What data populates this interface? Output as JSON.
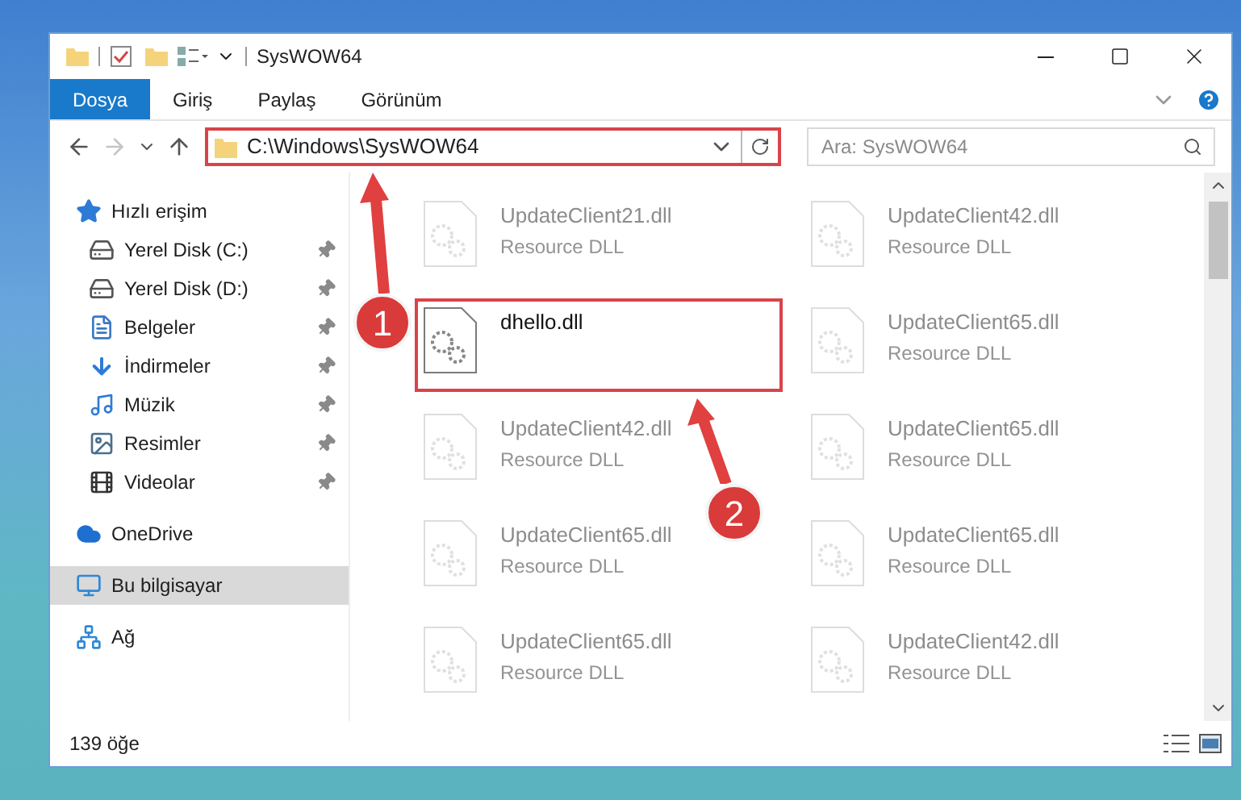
{
  "window": {
    "title": "SysWOW64"
  },
  "ribbon_tabs": [
    {
      "label": "Dosya",
      "selected": true
    },
    {
      "label": "Giriş",
      "selected": false
    },
    {
      "label": "Paylaş",
      "selected": false
    },
    {
      "label": "Görünüm",
      "selected": false
    }
  ],
  "address_bar": {
    "path": "C:\\Windows\\SysWOW64",
    "highlighted": true
  },
  "search": {
    "placeholder": "Ara: SysWOW64"
  },
  "sidebar": {
    "items": [
      {
        "label": "Hızlı erişim",
        "kind": "star",
        "selected": false,
        "children": [
          {
            "label": "Yerel Disk (C:)",
            "kind": "system-drive",
            "pinned": true,
            "selected": false
          },
          {
            "label": "Yerel Disk (D:)",
            "kind": "drive",
            "pinned": true,
            "selected": false
          },
          {
            "label": "Belgeler",
            "kind": "documents",
            "pinned": true,
            "selected": false
          },
          {
            "label": "İndirmeler",
            "kind": "downloads",
            "pinned": true,
            "selected": false
          },
          {
            "label": "Müzik",
            "kind": "music",
            "pinned": true,
            "selected": false
          },
          {
            "label": "Resimler",
            "kind": "pictures",
            "pinned": true,
            "selected": false
          },
          {
            "label": "Videolar",
            "kind": "videos",
            "pinned": true,
            "selected": false
          }
        ]
      },
      {
        "label": "OneDrive",
        "kind": "cloud",
        "selected": false
      },
      {
        "label": "Bu bilgisayar",
        "kind": "computer",
        "selected": true
      },
      {
        "label": "Ağ",
        "kind": "network",
        "selected": false
      }
    ]
  },
  "files": [
    {
      "name": "UpdateClient21.dll",
      "type": "Resource DLL",
      "highlighted": false
    },
    {
      "name": "UpdateClient42.dll",
      "type": "Resource DLL",
      "highlighted": false
    },
    {
      "name": "dhello.dll",
      "highlighted": true
    },
    {
      "name": "UpdateClient65.dll",
      "type": "Resource DLL",
      "highlighted": false
    },
    {
      "name": "UpdateClient42.dll",
      "type": "Resource DLL",
      "highlighted": false
    },
    {
      "name": "UpdateClient65.dll",
      "type": "Resource DLL",
      "highlighted": false
    },
    {
      "name": "UpdateClient65.dll",
      "type": "Resource DLL",
      "highlighted": false
    },
    {
      "name": "UpdateClient65.dll",
      "type": "Resource DLL",
      "highlighted": false
    },
    {
      "name": "UpdateClient65.dll",
      "type": "Resource DLL",
      "highlighted": false
    },
    {
      "name": "UpdateClient42.dll",
      "type": "Resource DLL",
      "highlighted": false
    }
  ],
  "status_bar": {
    "count": "139 öğe"
  },
  "annotations": [
    {
      "number": "1"
    },
    {
      "number": "2"
    }
  ]
}
